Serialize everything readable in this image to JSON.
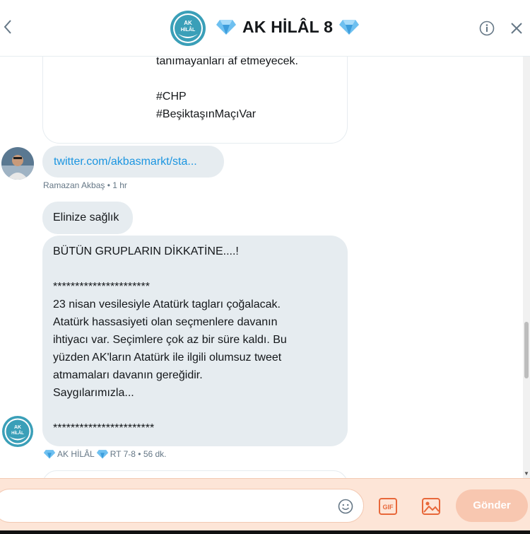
{
  "header": {
    "title": "AK HİLÂL 8",
    "avatar_text": [
      "AK",
      "HİLÂL"
    ]
  },
  "messages": {
    "first_bubble_lines": [
      "tanımayanları af etmeyecek.",
      "",
      "#CHP",
      "#BeşiktaşınMaçıVar"
    ],
    "link": "twitter.com/akbasmarkt/sta...",
    "meta1": "Ramazan Akbaş • 1 hr",
    "short_message": "Elinize sağlık",
    "long_message": "BÜTÜN GRUPLARIN DİKKATİNE....!\n\n**********************\n23 nisan vesilesiyle Atatürk tagları çoğalacak.\nAtatürk hassasiyeti olan seçmenlere davanın\nihtiyacı var. Seçimlere çok az bir süre kaldı. Bu\nyüzden AK'ların Atatürk ile ilgili olumsuz tweet\natmamaları davanın gereğidir.\nSaygılarımızla...\n\n***********************",
    "meta2_name": "AK HİLÂL",
    "meta2_rest": "RT 7-8 • 56 dk."
  },
  "composer": {
    "send_label": "Gönder",
    "gif_label": "GIF"
  },
  "colors": {
    "link": "#1b95e0",
    "bubble": "#e6ecf0",
    "composer_bg": "#fde5d7",
    "send_bg": "#f8c7b0",
    "diamond": "#4aa8e8"
  },
  "icons": [
    "back-chevron-icon",
    "diamond-icon",
    "info-icon",
    "close-icon",
    "emoji-icon",
    "gif-icon",
    "image-icon"
  ]
}
